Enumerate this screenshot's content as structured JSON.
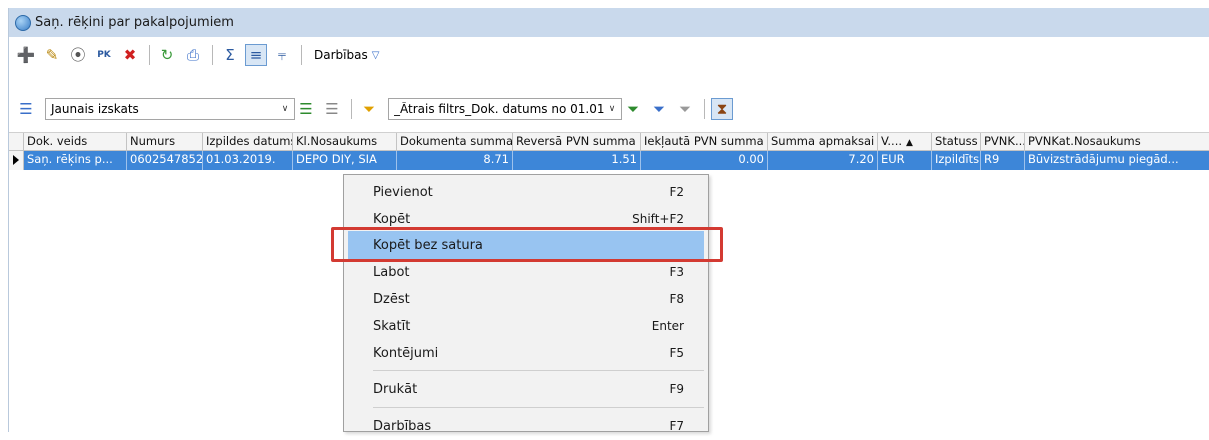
{
  "window": {
    "title": "Saņ. rēķini par pakalpojumiem"
  },
  "toolbar": {
    "buttons": [
      "add-icon",
      "edit-icon",
      "binoculars-icon",
      "pk-icon",
      "delete-icon",
      "refresh-icon",
      "print-icon",
      "sum-icon",
      "columns-icon",
      "tree-icon"
    ],
    "actions_label": "Darbības"
  },
  "view": {
    "current": "Jaunais izskats",
    "filter": "_Ātrais filtrs_Dok. datums no 01.01."
  },
  "grid": {
    "columns": [
      "Dok. veids",
      "Numurs",
      "Izpildes datums",
      "Kl.Nosaukums",
      "Dokumenta summa",
      "Reversā PVN summa",
      "Iekļautā PVN summa",
      "Summa apmaksai",
      "V....",
      "Statuss",
      "PVNK...",
      "PVNKat.Nosaukums"
    ],
    "rows": [
      {
        "dok_veids": "Saņ. rēķins p...",
        "numurs": "0602547852",
        "izpildes_datums": "01.03.2019.",
        "kl_nosaukums": "DEPO DIY, SIA",
        "dok_summa": "8.71",
        "reversa_pvn": "1.51",
        "ieklauta_pvn": "0.00",
        "summa_apmaksai": "7.20",
        "valuta": "EUR",
        "statuss": "Izpildīts",
        "pvnk": "R9",
        "pvnkat_nosaukums": "Būvizstrādājumu piegād..."
      }
    ]
  },
  "context_menu": {
    "items": [
      {
        "label": "Pievienot",
        "shortcut": "F2"
      },
      {
        "label": "Kopēt",
        "shortcut": "Shift+F2"
      },
      {
        "label": "Kopēt bez satura",
        "shortcut": ""
      },
      {
        "label": "Labot",
        "shortcut": "F3"
      },
      {
        "label": "Dzēst",
        "shortcut": "F8"
      },
      {
        "label": "Skatīt",
        "shortcut": "Enter"
      },
      {
        "label": "Kontējumi",
        "shortcut": "F5"
      },
      {
        "label": "Drukāt",
        "shortcut": "F9"
      },
      {
        "label": "Darbības",
        "shortcut": "F7"
      }
    ],
    "highlighted_index": 2
  },
  "colors": {
    "selection": "#3d86d8",
    "menu_highlight": "#98c4f1",
    "annotation_box": "#d33a32",
    "titlebar": "#c9d9ec"
  }
}
